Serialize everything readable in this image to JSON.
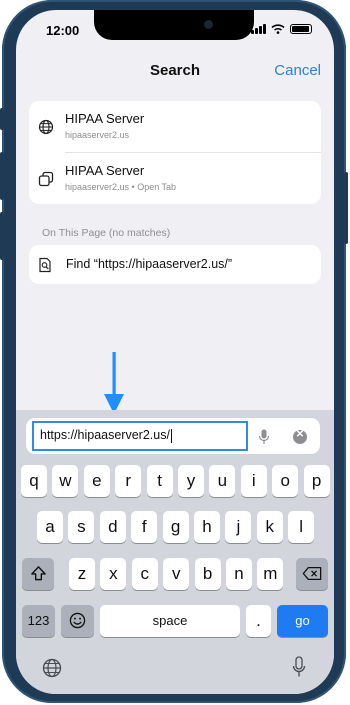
{
  "status": {
    "time": "12:00"
  },
  "header": {
    "title": "Search",
    "cancel": "Cancel"
  },
  "results": [
    {
      "title": "HIPAA Server",
      "subtitle": "hipaaserver2.us",
      "icon": "globe-icon"
    },
    {
      "title": "HIPAA Server",
      "subtitle": "hipaaserver2.us • Open Tab",
      "icon": "tabs-icon"
    }
  ],
  "on_page": {
    "label": "On This Page (no matches)",
    "find_text": "Find “https://hipaaserver2.us/”",
    "icon": "find-in-page-icon"
  },
  "url_field": {
    "value": "https://hipaaserver2.us/"
  },
  "keyboard": {
    "row1": [
      "q",
      "w",
      "e",
      "r",
      "t",
      "y",
      "u",
      "i",
      "o",
      "p"
    ],
    "row2": [
      "a",
      "s",
      "d",
      "f",
      "g",
      "h",
      "j",
      "k",
      "l"
    ],
    "row3": [
      "z",
      "x",
      "c",
      "v",
      "b",
      "n",
      "m"
    ],
    "numbers_key": "123",
    "space_key": "space",
    "period_key": ".",
    "go_key": "go"
  },
  "colors": {
    "accent": "#2d7fe0",
    "arrow": "#1e90ff",
    "go_key": "#1e7bf2"
  }
}
